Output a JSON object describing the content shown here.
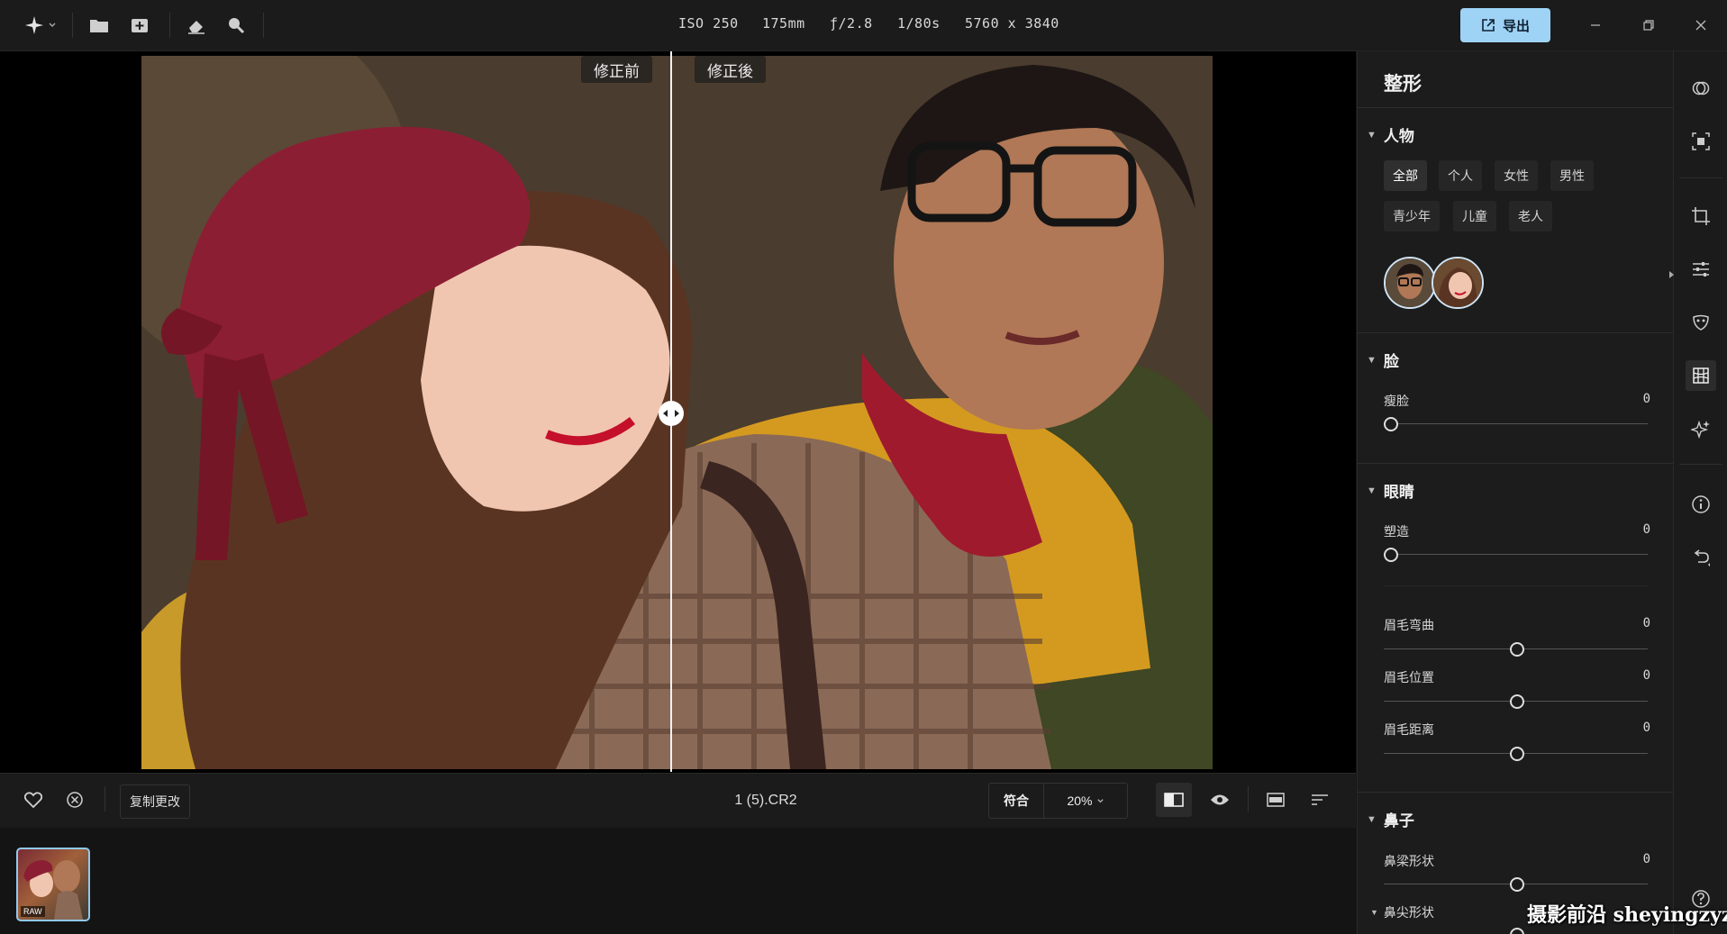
{
  "topbar": {
    "exif": {
      "iso": "ISO 250",
      "focal": "175mm",
      "aperture": "ƒ/2.8",
      "shutter": "1/80s",
      "resolution": "5760 x 3840"
    },
    "export_label": "导出"
  },
  "canvas": {
    "before_label": "修正前",
    "after_label": "修正後"
  },
  "bottombar": {
    "copy_changes": "复制更改",
    "filename": "1 (5).CR2",
    "fit_label": "符合",
    "zoom": "20%"
  },
  "filmstrip": {
    "raw_tag": "RAW"
  },
  "panel": {
    "title": "整形",
    "people": {
      "header": "人物",
      "tags": [
        "全部",
        "个人",
        "女性",
        "男性",
        "青少年",
        "儿童",
        "老人"
      ]
    },
    "face": {
      "header": "脸",
      "sliders": [
        {
          "label": "瘦脸",
          "value": "0"
        }
      ]
    },
    "eyes": {
      "header": "眼睛",
      "sliders": [
        {
          "label": "塑造",
          "value": "0"
        },
        {
          "label": "眉毛弯曲",
          "value": "0"
        },
        {
          "label": "眉毛位置",
          "value": "0"
        },
        {
          "label": "眉毛距离",
          "value": "0"
        }
      ]
    },
    "nose": {
      "header": "鼻子",
      "sliders": [
        {
          "label": "鼻梁形状",
          "value": "0"
        }
      ],
      "sub_header": "鼻尖形状"
    }
  },
  "watermark": "摄影前沿 sheyingzyz.com"
}
